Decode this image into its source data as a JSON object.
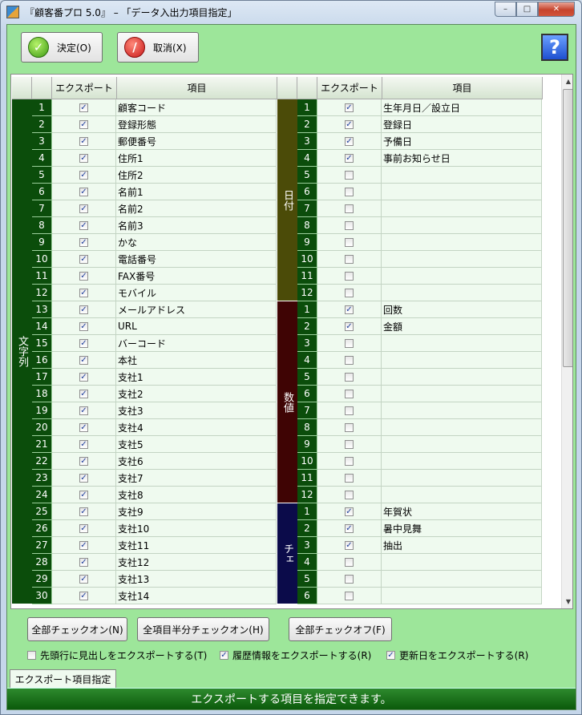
{
  "window": {
    "title": "『顧客番プロ 5.0』 – 「データ入出力項目指定」",
    "minimize": "–",
    "maximize": "□",
    "close": "✕"
  },
  "toolbar": {
    "ok_label": "決定(O)",
    "ok_icon": "check-icon",
    "cancel_label": "取消(X)",
    "cancel_icon": "no-entry-icon",
    "help_label": "?"
  },
  "grid": {
    "headers": {
      "export": "エクスポート",
      "item": "項目"
    },
    "left_group": {
      "label": "文字列",
      "color": "#0b4d0b"
    },
    "left_rows": [
      {
        "no": "1",
        "checked": true,
        "label": "顧客コード"
      },
      {
        "no": "2",
        "checked": true,
        "label": "登録形態"
      },
      {
        "no": "3",
        "checked": true,
        "label": "郵便番号"
      },
      {
        "no": "4",
        "checked": true,
        "label": "住所1"
      },
      {
        "no": "5",
        "checked": true,
        "label": "住所2"
      },
      {
        "no": "6",
        "checked": true,
        "label": "名前1"
      },
      {
        "no": "7",
        "checked": true,
        "label": "名前2"
      },
      {
        "no": "8",
        "checked": true,
        "label": "名前3"
      },
      {
        "no": "9",
        "checked": true,
        "label": "かな"
      },
      {
        "no": "10",
        "checked": true,
        "label": "電話番号"
      },
      {
        "no": "11",
        "checked": true,
        "label": "FAX番号"
      },
      {
        "no": "12",
        "checked": true,
        "label": "モバイル"
      },
      {
        "no": "13",
        "checked": true,
        "label": "メールアドレス"
      },
      {
        "no": "14",
        "checked": true,
        "label": "URL"
      },
      {
        "no": "15",
        "checked": true,
        "label": "バーコード"
      },
      {
        "no": "16",
        "checked": true,
        "label": "本社"
      },
      {
        "no": "17",
        "checked": true,
        "label": "支社1"
      },
      {
        "no": "18",
        "checked": true,
        "label": "支社2"
      },
      {
        "no": "19",
        "checked": true,
        "label": "支社3"
      },
      {
        "no": "20",
        "checked": true,
        "label": "支社4"
      },
      {
        "no": "21",
        "checked": true,
        "label": "支社5"
      },
      {
        "no": "22",
        "checked": true,
        "label": "支社6"
      },
      {
        "no": "23",
        "checked": true,
        "label": "支社7"
      },
      {
        "no": "24",
        "checked": true,
        "label": "支社8"
      },
      {
        "no": "25",
        "checked": true,
        "label": "支社9"
      },
      {
        "no": "26",
        "checked": true,
        "label": "支社10"
      },
      {
        "no": "27",
        "checked": true,
        "label": "支社11"
      },
      {
        "no": "28",
        "checked": true,
        "label": "支社12"
      },
      {
        "no": "29",
        "checked": true,
        "label": "支社13"
      },
      {
        "no": "30",
        "checked": true,
        "label": "支社14"
      }
    ],
    "right_groups": [
      {
        "label": "日付",
        "color": "#4b4b08",
        "rows": [
          {
            "no": "1",
            "checked": true,
            "label": "生年月日／設立日"
          },
          {
            "no": "2",
            "checked": true,
            "label": "登録日"
          },
          {
            "no": "3",
            "checked": true,
            "label": "予備日"
          },
          {
            "no": "4",
            "checked": true,
            "label": "事前お知らせ日"
          },
          {
            "no": "5",
            "checked": false,
            "label": ""
          },
          {
            "no": "6",
            "checked": false,
            "label": ""
          },
          {
            "no": "7",
            "checked": false,
            "label": ""
          },
          {
            "no": "8",
            "checked": false,
            "label": ""
          },
          {
            "no": "9",
            "checked": false,
            "label": ""
          },
          {
            "no": "10",
            "checked": false,
            "label": ""
          },
          {
            "no": "11",
            "checked": false,
            "label": ""
          },
          {
            "no": "12",
            "checked": false,
            "label": ""
          }
        ]
      },
      {
        "label": "数値",
        "color": "#3f0404",
        "rows": [
          {
            "no": "1",
            "checked": true,
            "label": "回数"
          },
          {
            "no": "2",
            "checked": true,
            "label": "金額"
          },
          {
            "no": "3",
            "checked": false,
            "label": ""
          },
          {
            "no": "4",
            "checked": false,
            "label": ""
          },
          {
            "no": "5",
            "checked": false,
            "label": ""
          },
          {
            "no": "6",
            "checked": false,
            "label": ""
          },
          {
            "no": "7",
            "checked": false,
            "label": ""
          },
          {
            "no": "8",
            "checked": false,
            "label": ""
          },
          {
            "no": "9",
            "checked": false,
            "label": ""
          },
          {
            "no": "10",
            "checked": false,
            "label": ""
          },
          {
            "no": "11",
            "checked": false,
            "label": ""
          },
          {
            "no": "12",
            "checked": false,
            "label": ""
          }
        ]
      },
      {
        "label": "チェ",
        "color": "#0b0b4a",
        "rows": [
          {
            "no": "1",
            "checked": true,
            "label": "年賀状"
          },
          {
            "no": "2",
            "checked": true,
            "label": "暑中見舞"
          },
          {
            "no": "3",
            "checked": true,
            "label": "抽出"
          },
          {
            "no": "4",
            "checked": false,
            "label": ""
          },
          {
            "no": "5",
            "checked": false,
            "label": ""
          },
          {
            "no": "6",
            "checked": false,
            "label": ""
          }
        ]
      }
    ]
  },
  "bottom": {
    "all_on": "全部チェックオン(N)",
    "half_on": "全項目半分チェックオン(H)",
    "all_off": "全部チェックオフ(F)",
    "opt1": {
      "label": "先頭行に見出しをエクスポートする(T)",
      "checked": false
    },
    "opt2": {
      "label": "履歴情報をエクスポートする(R)",
      "checked": true
    },
    "opt3": {
      "label": "更新日をエクスポートする(R)",
      "checked": true
    }
  },
  "tab": "エクスポート項目指定",
  "status": "エクスポートする項目を指定できます。"
}
